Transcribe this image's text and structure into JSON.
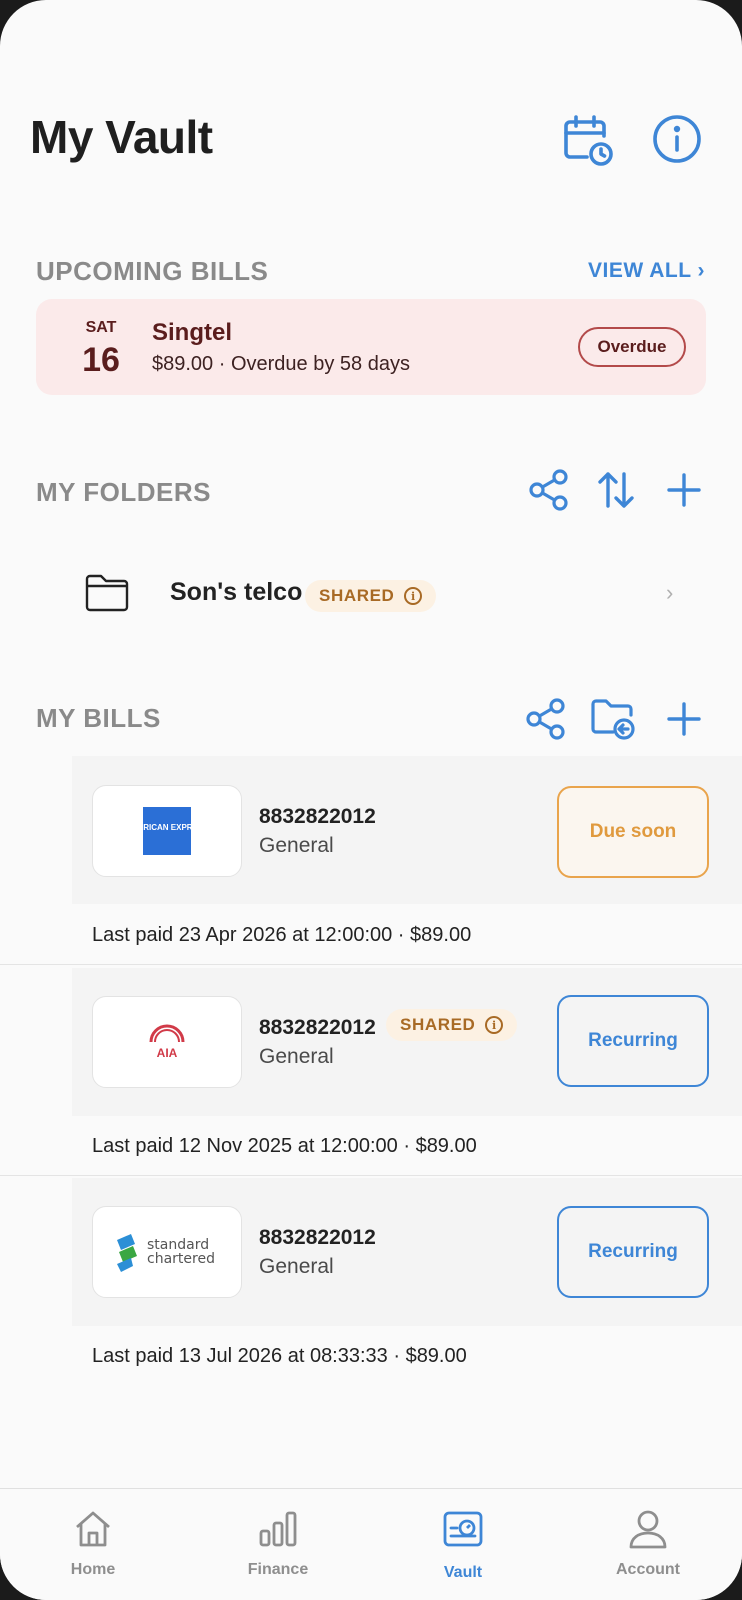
{
  "header": {
    "title": "My Vault",
    "calendar_icon": "calendar-clock-icon",
    "info_icon": "info-icon"
  },
  "upcoming": {
    "title": "UPCOMING BILLS",
    "view_all": "VIEW ALL ›",
    "bill": {
      "day_name": "SAT",
      "day_num": "16",
      "name": "Singtel",
      "detail": "$89.00 · Overdue by 58 days",
      "status": "Overdue"
    }
  },
  "folders": {
    "title": "MY FOLDERS",
    "items": [
      {
        "name": "Son's telco",
        "badge": "SHARED",
        "chevron": "›"
      }
    ]
  },
  "bills": {
    "title": "MY BILLS",
    "items": [
      {
        "logo": "american-express-logo",
        "logo_text": "AMERICAN EXPRESS",
        "account": "8832822012",
        "category": "General",
        "badge": "",
        "status": "Due soon",
        "last_paid": "Last paid 23 Apr 2026 at 12:00:00 · $89.00"
      },
      {
        "logo": "aia-logo",
        "logo_text": "AIA",
        "account": "8832822012",
        "category": "General",
        "badge": "SHARED",
        "status": "Recurring",
        "last_paid": "Last paid 12 Nov 2025 at 12:00:00 · $89.00"
      },
      {
        "logo": "standard-chartered-logo",
        "logo_text": "standard chartered",
        "account": "8832822012",
        "category": "General",
        "badge": "",
        "status": "Recurring",
        "last_paid": "Last paid 13 Jul 2026 at 08:33:33 · $89.00"
      }
    ]
  },
  "nav": {
    "items": [
      {
        "label": "Home",
        "icon": "home-icon"
      },
      {
        "label": "Finance",
        "icon": "bar-chart-icon"
      },
      {
        "label": "Vault",
        "icon": "vault-icon",
        "active": true
      },
      {
        "label": "Account",
        "icon": "person-icon"
      }
    ]
  },
  "colors": {
    "accent": "#3e86d6",
    "overdue_bg": "#fbeaea",
    "overdue_text": "#5a1d1d",
    "due_soon": "#e9a44c",
    "shared_text": "#a86a25",
    "shared_bg": "#fcf1e3"
  }
}
